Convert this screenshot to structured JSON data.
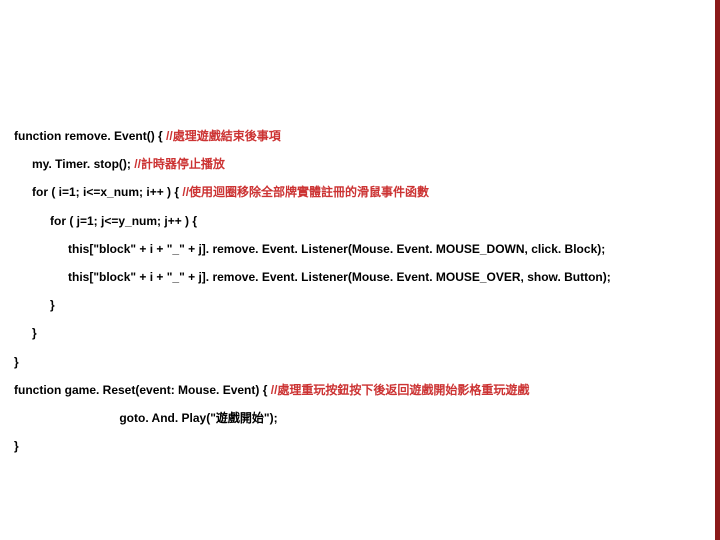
{
  "code": {
    "func1_sig": "function remove. Event() {",
    "c1": "//處理遊戲結束後事項",
    "stop": "my. Timer. stop();",
    "c2": "//計時器停止播放",
    "for_x": "for ( i=1; i<=x_num; i++ ) {",
    "c3": "//使用迴圈移除全部牌實體註冊的滑鼠事件函數",
    "for_y": "for ( j=1; j<=y_num; j++ ) {",
    "rem1": "this[\"block\" + i + \"_\" + j]. remove. Event. Listener(Mouse. Event. MOUSE_DOWN, click. Block);",
    "rem2": "this[\"block\" + i + \"_\" + j]. remove. Event. Listener(Mouse. Event. MOUSE_OVER, show. Button);",
    "close_y": "}",
    "close_x": "}",
    "close_f1": "}",
    "func2_sig": "function game. Reset(event: Mouse. Event) {",
    "c4": "//處理重玩按鈕按下後返回遊戲開始影格重玩遊戲",
    "goto": "goto. And. Play(\"遊戲開始\");",
    "close_f2": "}"
  }
}
